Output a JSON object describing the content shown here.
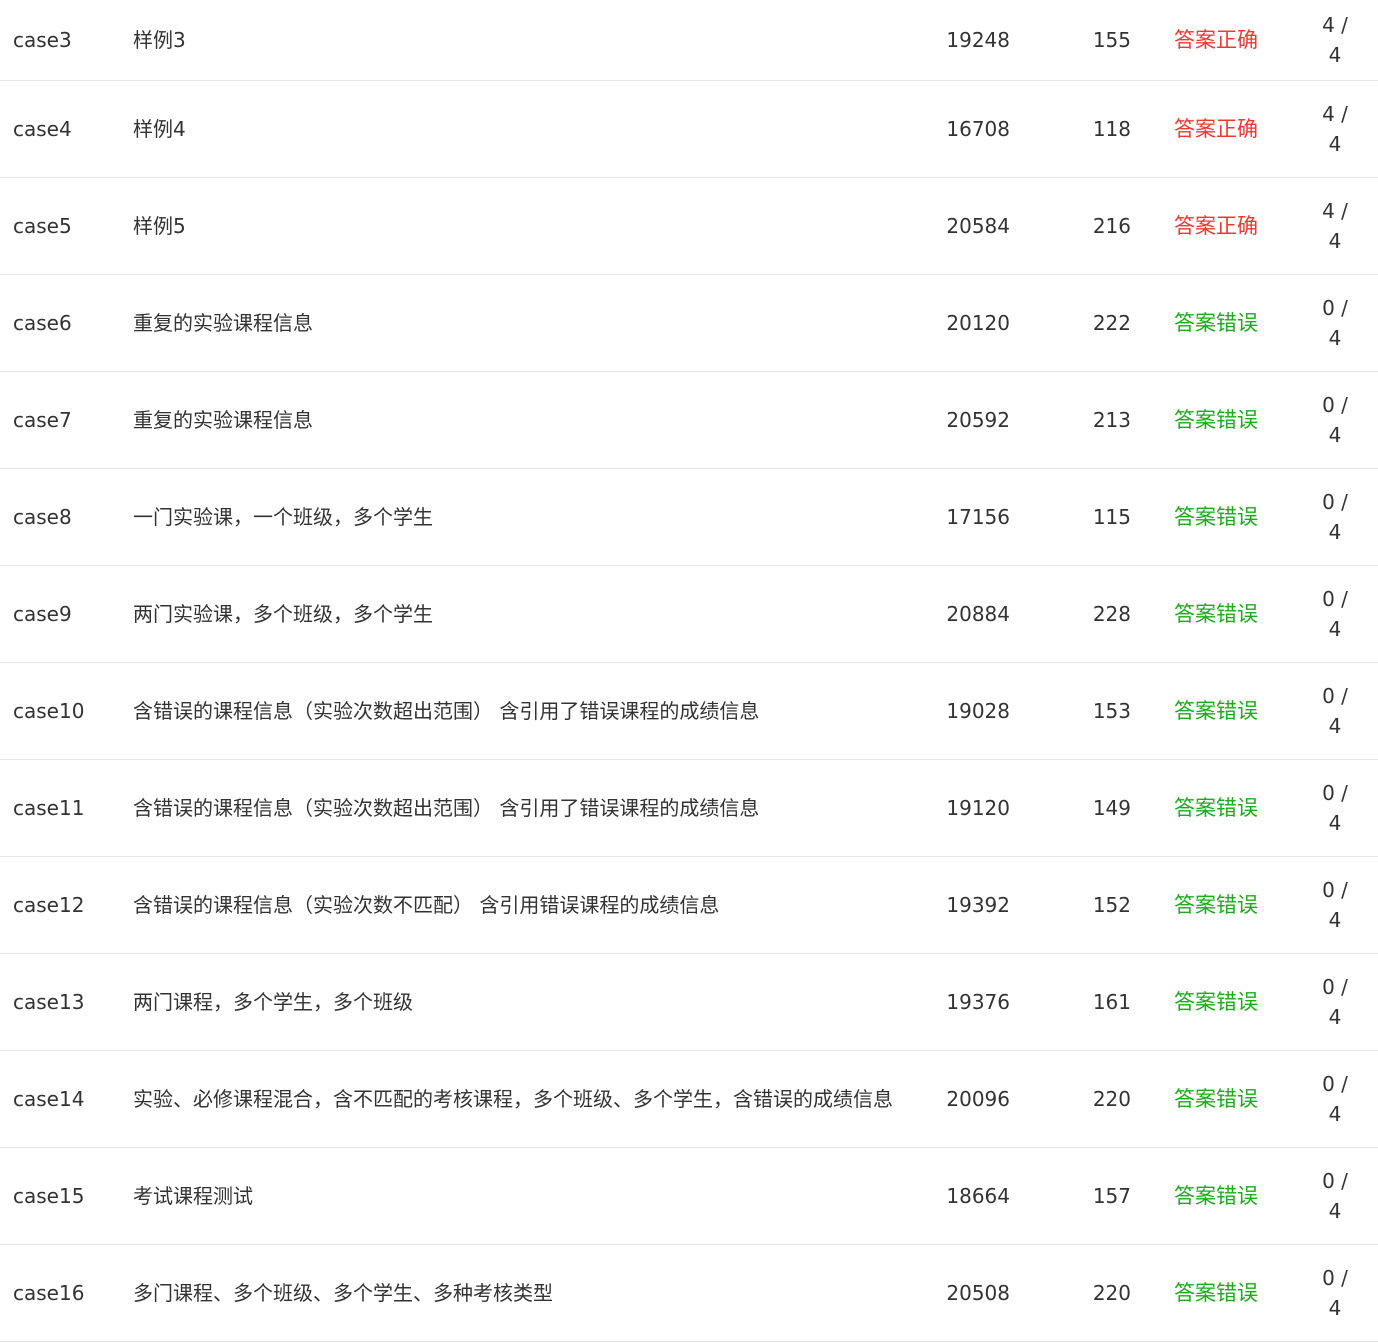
{
  "colors": {
    "correct": "#f0382e",
    "wrong": "#1aac19",
    "text": "#333333",
    "divider": "#e8e8e8"
  },
  "rows": [
    {
      "id": "case3",
      "desc": "样例3",
      "time": "19248",
      "mem": "155",
      "status": "答案正确",
      "status_type": "correct",
      "score_top": "4 /",
      "score_bottom": "4"
    },
    {
      "id": "case4",
      "desc": "样例4",
      "time": "16708",
      "mem": "118",
      "status": "答案正确",
      "status_type": "correct",
      "score_top": "4 /",
      "score_bottom": "4"
    },
    {
      "id": "case5",
      "desc": "样例5",
      "time": "20584",
      "mem": "216",
      "status": "答案正确",
      "status_type": "correct",
      "score_top": "4 /",
      "score_bottom": "4"
    },
    {
      "id": "case6",
      "desc": "重复的实验课程信息",
      "time": "20120",
      "mem": "222",
      "status": "答案错误",
      "status_type": "wrong",
      "score_top": "0 /",
      "score_bottom": "4"
    },
    {
      "id": "case7",
      "desc": "重复的实验课程信息",
      "time": "20592",
      "mem": "213",
      "status": "答案错误",
      "status_type": "wrong",
      "score_top": "0 /",
      "score_bottom": "4"
    },
    {
      "id": "case8",
      "desc": "一门实验课，一个班级，多个学生",
      "time": "17156",
      "mem": "115",
      "status": "答案错误",
      "status_type": "wrong",
      "score_top": "0 /",
      "score_bottom": "4"
    },
    {
      "id": "case9",
      "desc": "两门实验课，多个班级，多个学生",
      "time": "20884",
      "mem": "228",
      "status": "答案错误",
      "status_type": "wrong",
      "score_top": "0 /",
      "score_bottom": "4"
    },
    {
      "id": "case10",
      "desc": "含错误的课程信息（实验次数超出范围） 含引用了错误课程的成绩信息",
      "time": "19028",
      "mem": "153",
      "status": "答案错误",
      "status_type": "wrong",
      "score_top": "0 /",
      "score_bottom": "4"
    },
    {
      "id": "case11",
      "desc": "含错误的课程信息（实验次数超出范围） 含引用了错误课程的成绩信息",
      "time": "19120",
      "mem": "149",
      "status": "答案错误",
      "status_type": "wrong",
      "score_top": "0 /",
      "score_bottom": "4"
    },
    {
      "id": "case12",
      "desc": "含错误的课程信息（实验次数不匹配） 含引用错误课程的成绩信息",
      "time": "19392",
      "mem": "152",
      "status": "答案错误",
      "status_type": "wrong",
      "score_top": "0 /",
      "score_bottom": "4"
    },
    {
      "id": "case13",
      "desc": "两门课程，多个学生，多个班级",
      "time": "19376",
      "mem": "161",
      "status": "答案错误",
      "status_type": "wrong",
      "score_top": "0 /",
      "score_bottom": "4"
    },
    {
      "id": "case14",
      "desc": "实验、必修课程混合，含不匹配的考核课程，多个班级、多个学生，含错误的成绩信息",
      "time": "20096",
      "mem": "220",
      "status": "答案错误",
      "status_type": "wrong",
      "score_top": "0 /",
      "score_bottom": "4"
    },
    {
      "id": "case15",
      "desc": "考试课程测试",
      "time": "18664",
      "mem": "157",
      "status": "答案错误",
      "status_type": "wrong",
      "score_top": "0 /",
      "score_bottom": "4"
    },
    {
      "id": "case16",
      "desc": "多门课程、多个班级、多个学生、多种考核类型",
      "time": "20508",
      "mem": "220",
      "status": "答案错误",
      "status_type": "wrong",
      "score_top": "0 /",
      "score_bottom": "4"
    }
  ]
}
